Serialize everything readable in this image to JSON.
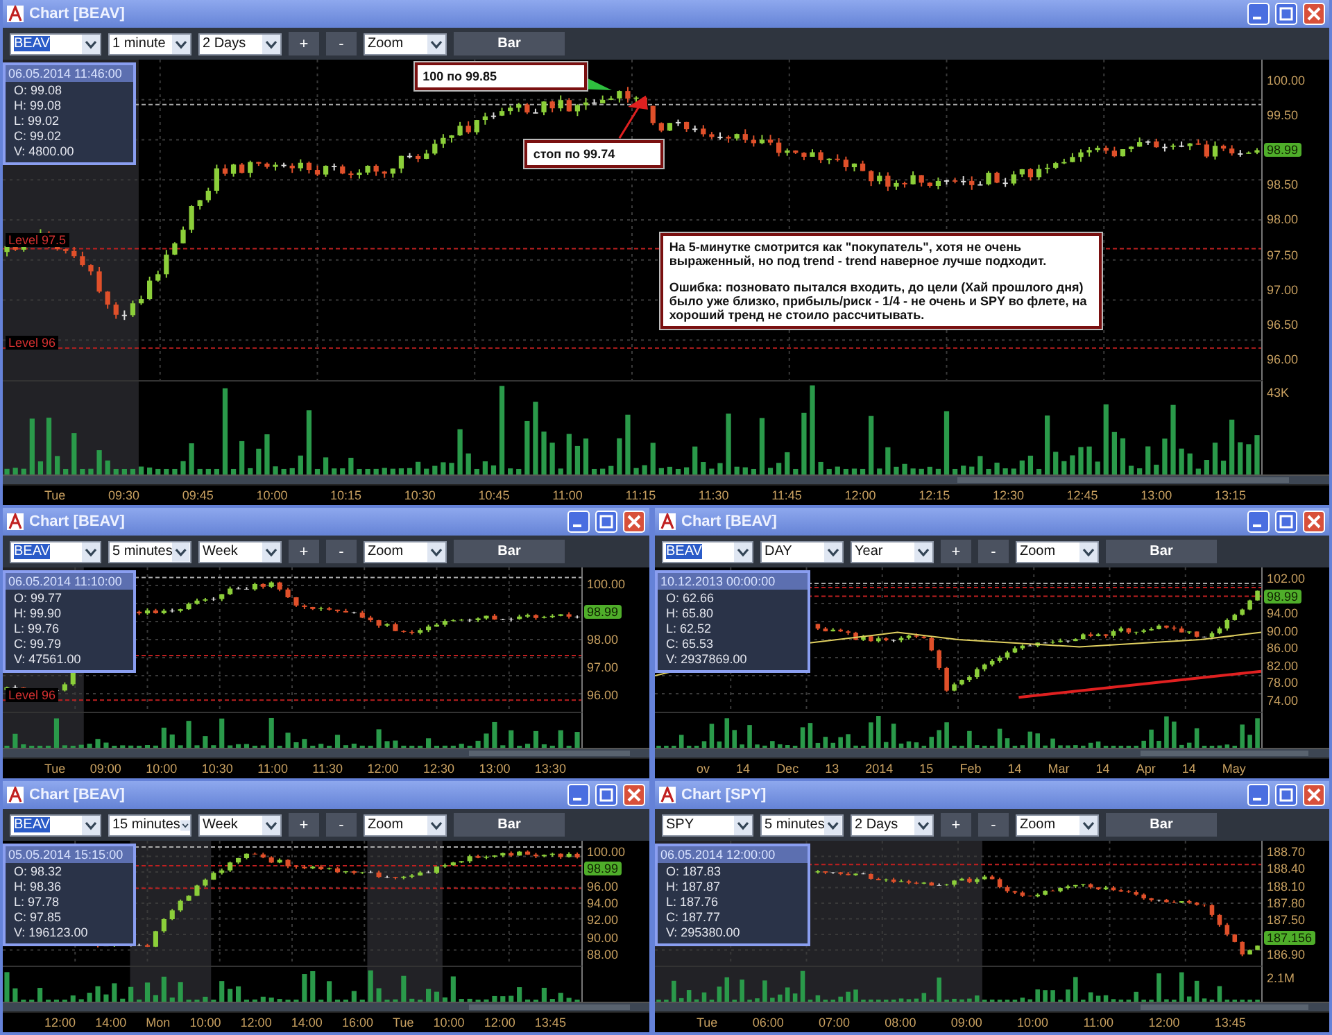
{
  "windows": [
    {
      "title": "Chart [BEAV]",
      "toolbar": {
        "symbol": {
          "text": "BEAV",
          "selected": true
        },
        "interval": "1 minute",
        "range": "2 Days",
        "plus": "+",
        "minus": "-",
        "zoom": "Zoom",
        "mode": "Bar"
      },
      "info": {
        "datetime": "06.05.2014 11:46:00",
        "lines": [
          "O: 99.08",
          "H: 99.08",
          "L: 99.02",
          "C: 99.02",
          "V: 4800.00"
        ]
      },
      "levels": [
        "Level 97.5",
        "Level 96"
      ],
      "notes": [
        {
          "paragraphs": [
            "100 по 99.85"
          ]
        },
        {
          "paragraphs": [
            "стоп по 99.74"
          ]
        },
        {
          "paragraphs": [
            "На 5-минутке смотрится как \"покупатель\", хотя не очень выраженный, но под trend - trend наверное лучше подходит.",
            "Ошибка: позновато пытался входить, до цели (Хай прошлого дня) было уже близко, прибыль/риск - 1/4 - не очень и SPY во флете, на хороший тренд не стоило рассчитывать."
          ]
        }
      ],
      "price_axis": [
        {
          "kind": "label",
          "text": "100.00"
        },
        {
          "kind": "label",
          "text": "99.50"
        },
        {
          "kind": "badge",
          "text": "98.99"
        },
        {
          "kind": "label",
          "text": "98.50"
        },
        {
          "kind": "label",
          "text": "98.00"
        },
        {
          "kind": "label",
          "text": "97.50"
        },
        {
          "kind": "label",
          "text": "97.00"
        },
        {
          "kind": "label",
          "text": "96.50"
        },
        {
          "kind": "label",
          "text": "96.00"
        }
      ],
      "volume_label": "43K",
      "time_axis": [
        "Tue",
        "09:30",
        "09:45",
        "10:00",
        "10:15",
        "10:30",
        "10:45",
        "11:00",
        "11:15",
        "11:30",
        "11:45",
        "12:00",
        "12:15",
        "12:30",
        "12:45",
        "13:00",
        "13:15"
      ]
    },
    {
      "title": "Chart [BEAV]",
      "toolbar": {
        "symbol": {
          "text": "BEAV",
          "selected": true
        },
        "interval": "5 minutes",
        "range": "Week",
        "plus": "+",
        "minus": "-",
        "zoom": "Zoom",
        "mode": "Bar"
      },
      "info": {
        "datetime": "06.05.2014 11:10:00",
        "lines": [
          "O: 99.77",
          "H: 99.90",
          "L: 99.76",
          "C: 99.79",
          "V: 47561.00"
        ]
      },
      "levels": [
        "Level 96"
      ],
      "price_axis": [
        {
          "kind": "label",
          "text": "100.00"
        },
        {
          "kind": "badge",
          "text": "98.99"
        },
        {
          "kind": "label",
          "text": "98.00"
        },
        {
          "kind": "label",
          "text": "97.00"
        },
        {
          "kind": "label",
          "text": "96.00"
        }
      ],
      "time_axis": [
        "Tue",
        "09:00",
        "10:00",
        "10:30",
        "11:00",
        "11:30",
        "12:00",
        "12:30",
        "13:00",
        "13:30"
      ]
    },
    {
      "title": "Chart [BEAV]",
      "toolbar": {
        "symbol": {
          "text": "BEAV",
          "selected": true
        },
        "interval": "DAY",
        "range": "Year",
        "plus": "+",
        "minus": "-",
        "zoom": "Zoom",
        "mode": "Bar"
      },
      "info": {
        "datetime": "10.12.2013 00:00:00",
        "lines": [
          "O: 62.66",
          "H: 65.80",
          "L: 62.52",
          "C: 65.53",
          "V: 2937869.00"
        ]
      },
      "price_axis": [
        {
          "kind": "label",
          "text": "102.00"
        },
        {
          "kind": "badge",
          "text": "98.99"
        },
        {
          "kind": "label",
          "text": "94.00"
        },
        {
          "kind": "label",
          "text": "90.00"
        },
        {
          "kind": "label",
          "text": "86.00"
        },
        {
          "kind": "label",
          "text": "82.00"
        },
        {
          "kind": "label",
          "text": "78.00"
        },
        {
          "kind": "label",
          "text": "74.00"
        }
      ],
      "time_axis": [
        "ov",
        "14",
        "Dec",
        "13",
        "2014",
        "15",
        "Feb",
        "14",
        "Mar",
        "14",
        "Apr",
        "14",
        "May"
      ]
    },
    {
      "title": "Chart [BEAV]",
      "toolbar": {
        "symbol": {
          "text": "BEAV",
          "selected": true
        },
        "interval": "15 minutes",
        "range": "Week",
        "plus": "+",
        "minus": "-",
        "zoom": "Zoom",
        "mode": "Bar"
      },
      "info": {
        "datetime": "05.05.2014 15:15:00",
        "lines": [
          "O: 98.32",
          "H: 98.36",
          "L: 97.78",
          "C: 97.85",
          "V: 196123.00"
        ]
      },
      "price_axis": [
        {
          "kind": "label",
          "text": "100.00"
        },
        {
          "kind": "badge",
          "text": "98.99"
        },
        {
          "kind": "label",
          "text": "96.00"
        },
        {
          "kind": "label",
          "text": "94.00"
        },
        {
          "kind": "label",
          "text": "92.00"
        },
        {
          "kind": "label",
          "text": "90.00"
        },
        {
          "kind": "label",
          "text": "88.00"
        }
      ],
      "time_axis": [
        "12:00",
        "14:00",
        "Mon",
        "10:00",
        "12:00",
        "14:00",
        "16:00",
        "Tue",
        "10:00",
        "12:00",
        "13:45"
      ]
    },
    {
      "title": "Chart [SPY]",
      "toolbar": {
        "symbol": {
          "text": "SPY",
          "selected": false
        },
        "interval": "5 minutes",
        "range": "2 Days",
        "plus": "+",
        "minus": "-",
        "zoom": "Zoom",
        "mode": "Bar"
      },
      "info": {
        "datetime": "06.05.2014 12:00:00",
        "lines": [
          "O: 187.83",
          "H: 187.87",
          "L: 187.76",
          "C: 187.77",
          "V: 295380.00"
        ]
      },
      "price_axis": [
        {
          "kind": "label",
          "text": "188.70"
        },
        {
          "kind": "label",
          "text": "188.40"
        },
        {
          "kind": "label",
          "text": "188.10"
        },
        {
          "kind": "label",
          "text": "187.80"
        },
        {
          "kind": "label",
          "text": "187.50"
        },
        {
          "kind": "badge",
          "text": "187.156"
        },
        {
          "kind": "label",
          "text": "186.90"
        }
      ],
      "volume_label": "2.1M",
      "time_axis": [
        "Tue",
        "06:00",
        "07:00",
        "08:00",
        "09:00",
        "10:00",
        "11:00",
        "12:00",
        "13:45"
      ]
    }
  ]
}
